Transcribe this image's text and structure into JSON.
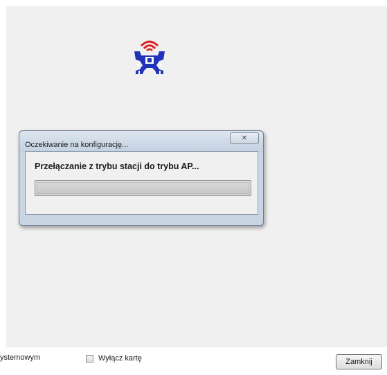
{
  "logo": {
    "icon": "wireless-adapter-logo-icon"
  },
  "dialog": {
    "title": "Oczekiwanie na konfigurację...",
    "close_glyph": "✕",
    "message": "Przełączanie z trybu stacji do trybu AP...",
    "progress_fraction": 0
  },
  "bottom": {
    "partial_label": "ystemowym",
    "checkbox_label": "Wyłącz kartę",
    "checkbox_checked": false,
    "close_button_label": "Zamknij"
  },
  "colors": {
    "panel": "#f0f0f0",
    "dialog_frame": "#c9d5e3",
    "logo_blue": "#2233bb",
    "logo_red": "#dd2222"
  }
}
